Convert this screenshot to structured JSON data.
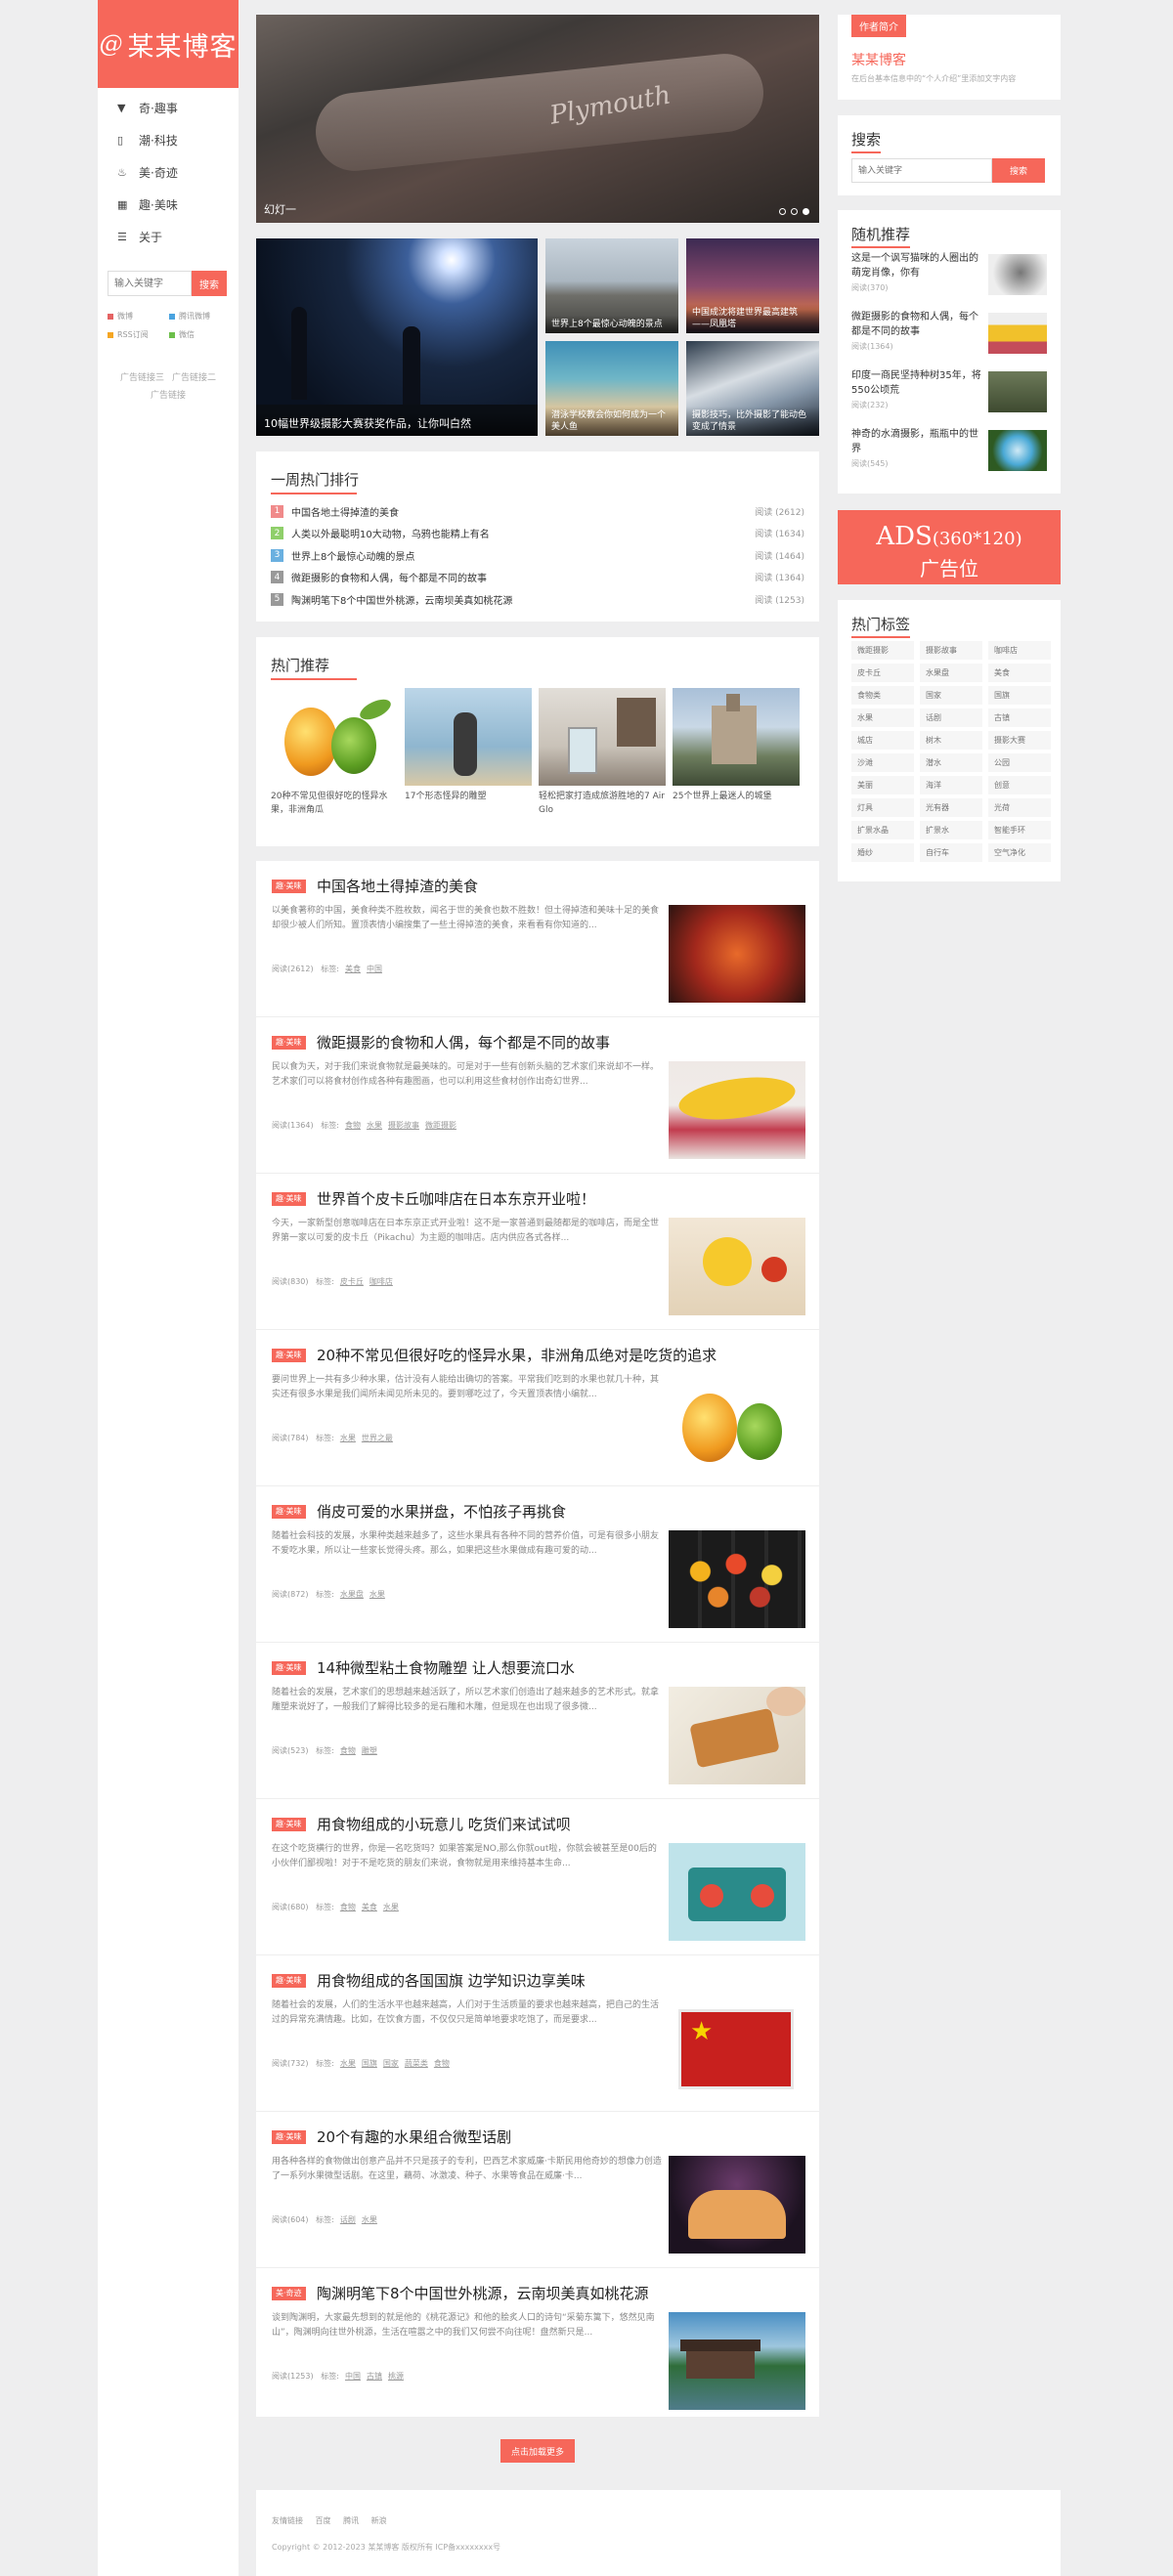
{
  "site": {
    "logo_text": "某某博客",
    "logo_mark": "@"
  },
  "nav": [
    {
      "icon": "funnel-icon",
      "glyph": "▼",
      "label": "奇·趣事"
    },
    {
      "icon": "phone-icon",
      "glyph": "▯",
      "label": "潮·科技"
    },
    {
      "icon": "flame-icon",
      "glyph": "♨",
      "label": "美·奇迹"
    },
    {
      "icon": "grid-icon",
      "glyph": "▦",
      "label": "趣·美味"
    },
    {
      "icon": "list-icon",
      "glyph": "☰",
      "label": "关于"
    }
  ],
  "left_search": {
    "placeholder": "输入关键字",
    "button": "搜索"
  },
  "share": [
    {
      "label": "微博",
      "color": "#e46363"
    },
    {
      "label": "腾讯微博",
      "color": "#4aa3df"
    },
    {
      "label": "RSS订阅",
      "color": "#f5a623"
    },
    {
      "label": "微信",
      "color": "#6cbf4a"
    }
  ],
  "left_links": [
    "广告链接三",
    "广告链接二",
    "广告链接"
  ],
  "slider": {
    "caption": "幻灯一",
    "signature": "Plymouth"
  },
  "mosaic": {
    "big": "10幅世界级摄影大赛获奖作品，让你叫白然",
    "t1": "世界上8个最惊心动魄的景点",
    "t2": "中国成沈将建世界最高建筑——凤凰塔",
    "t3": "潜泳学校教会你如何成为一个美人鱼",
    "t4": "摄影技巧，比外摄影了能动色变成了情景"
  },
  "hot_rank": {
    "title": "一周热门排行",
    "items": [
      {
        "n": "1",
        "title": "中国各地土得掉渣的美食",
        "views": "阅读 (2612)",
        "color": "#f08a8a"
      },
      {
        "n": "2",
        "title": "人类以外最聪明10大动物，乌鸦也能精上有名",
        "views": "阅读 (1634)",
        "color": "#8fcf6a"
      },
      {
        "n": "3",
        "title": "世界上8个最惊心动魄的景点",
        "views": "阅读 (1464)",
        "color": "#6ab0e0"
      },
      {
        "n": "4",
        "title": "微距摄影的食物和人偶，每个都是不同的故事",
        "views": "阅读 (1364)",
        "color": "#999999"
      },
      {
        "n": "5",
        "title": "陶渊明笔下8个中国世外桃源，云南坝美真如桃花源",
        "views": "阅读 (1253)",
        "color": "#999999"
      }
    ]
  },
  "recommend": {
    "title": "热门推荐",
    "items": [
      {
        "title": "20种不常见但很好吃的怪异水果，非洲角瓜"
      },
      {
        "title": "17个形态怪异的雕塑"
      },
      {
        "title": "轻松把家打造成旅游胜地的7 Air Glo"
      },
      {
        "title": "25个世界上最迷人的城堡"
      }
    ]
  },
  "articles": [
    {
      "badge": "趣·美味",
      "title": "中国各地土得掉渣的美食",
      "excerpt": "以美食著称的中国，美食种类不胜枚数，闻名于世的美食也数不胜数！但土得掉渣和美味十足的美食却很少被人们所知。置顶表情小编搜集了一些土得掉渣的美食，来看看有你知道的...",
      "views": "阅读(2612)",
      "tagl": "标签:",
      "tags": [
        "美食",
        "中国"
      ]
    },
    {
      "badge": "趣·美味",
      "title": "微距摄影的食物和人偶，每个都是不同的故事",
      "excerpt": "民以食为天，对于我们来说食物就是最美味的。可是对于一些有创新头脑的艺术家们来说却不一样。艺术家们可以将食材创作成各种有趣图画，也可以利用这些食材创作出奇幻世界...",
      "views": "阅读(1364)",
      "tagl": "标签:",
      "tags": [
        "食物",
        "水果",
        "摄影故事",
        "微距摄影"
      ]
    },
    {
      "badge": "趣·美味",
      "title": "世界首个皮卡丘咖啡店在日本东京开业啦！",
      "excerpt": "今天，一家新型创意咖啡店在日本东京正式开业啦！这不是一家普通到最随都是的咖啡店，而是全世界第一家以可爱的皮卡丘（Pikachu）为主题的咖啡店。店内供应各式各样...",
      "views": "阅读(830)",
      "tagl": "标签:",
      "tags": [
        "皮卡丘",
        "咖啡店"
      ]
    },
    {
      "badge": "趣·美味",
      "title": "20种不常见但很好吃的怪异水果，非洲角瓜绝对是吃货的追求",
      "excerpt": "要问世界上一共有多少种水果，估计没有人能给出确切的答案。平常我们吃到的水果也就几十种，其实还有很多水果是我们闻所未闻见所未见的。要到哪吃过了，今天置顶表情小编就...",
      "views": "阅读(784)",
      "tagl": "标签:",
      "tags": [
        "水果",
        "世界之最"
      ]
    },
    {
      "badge": "趣·美味",
      "title": "俏皮可爱的水果拼盘，不怕孩子再挑食",
      "excerpt": "随着社会科技的发展，水果种类越来越多了，这些水果具有各种不同的营养价值，可是有很多小朋友不爱吃水果，所以让一些家长觉得头疼。那么，如果把这些水果做成有趣可爱的动...",
      "views": "阅读(872)",
      "tagl": "标签:",
      "tags": [
        "水果盘",
        "水果"
      ]
    },
    {
      "badge": "趣·美味",
      "title": "14种微型粘土食物雕塑 让人想要流口水",
      "excerpt": "随着社会的发展，艺术家们的思想越来越活跃了，所以艺术家们创造出了越来越多的艺术形式。就拿雕塑来说好了，一般我们了解得比较多的是石雕和木雕，但是现在也出现了很多微...",
      "views": "阅读(523)",
      "tagl": "标签:",
      "tags": [
        "食物",
        "雕塑"
      ]
    },
    {
      "badge": "趣·美味",
      "title": "用食物组成的小玩意儿 吃货们来试试呗",
      "excerpt": "在这个吃货横行的世界，你是一名吃货吗？如果答案是NO,那么你就out啦，你就会被甚至是00后的小伙伴们鄙视啦！对于不是吃货的朋友们来说，食物就是用来维持基本生命...",
      "views": "阅读(680)",
      "tagl": "标签:",
      "tags": [
        "食物",
        "美食",
        "水果"
      ]
    },
    {
      "badge": "趣·美味",
      "title": "用食物组成的各国国旗 边学知识边享美味",
      "excerpt": "随着社会的发展，人们的生活水平也越来越高，人们对于生活质量的要求也越来越高，把自己的生活过的异常充满情趣。比如，在饮食方面，不仅仅只是简单地要求吃饱了，而是要求...",
      "views": "阅读(732)",
      "tagl": "标签:",
      "tags": [
        "水果",
        "国旗",
        "国家",
        "蔬菜类",
        "食物"
      ]
    },
    {
      "badge": "趣·美味",
      "title": "20个有趣的水果组合微型话剧",
      "excerpt": "用各种各样的食物做出创意产品并不只是孩子的专利，巴西艺术家威廉·卡斯民用他奇妙的想像力创造了一系列水果微型话剧。在这里，藕荷、冰激凌、种子、水果等食品在威廉·卡...",
      "views": "阅读(604)",
      "tagl": "标签:",
      "tags": [
        "话剧",
        "水果"
      ]
    },
    {
      "badge": "美·奇迹",
      "title": "陶渊明笔下8个中国世外桃源，云南坝美真如桃花源",
      "excerpt": "谈到陶渊明，大家最先想到的就是他的《桃花源记》和他的脍炙人口的诗句“采菊东篱下，悠然见南山”，陶渊明向往世外桃源，生活在喧嚣之中的我们又何尝不向往呢！盘然新只是...",
      "views": "阅读(1253)",
      "tagl": "标签:",
      "tags": [
        "中国",
        "古镇",
        "桃源"
      ]
    }
  ],
  "more_button": "点击加载更多",
  "footer": {
    "links": [
      "友情链接",
      "百度",
      "腾讯",
      "新浪"
    ],
    "copyright": "Copyright © 2012-2023 某某博客 版权所有 ICP备xxxxxxxx号"
  },
  "right": {
    "intro_tag": "作者简介",
    "intro_name": "某某博客",
    "intro_desc": "在后台基本信息中的“个人介绍”里添加文字内容",
    "search_title": "搜索",
    "search_placeholder": "输入关键字",
    "search_button": "搜索",
    "random_title": "随机推荐",
    "random": [
      {
        "title": "这是一个讽写猫咪的人圈出的萌宠肖像，你有",
        "views": "阅读(370)"
      },
      {
        "title": "微距摄影的食物和人偶，每个都是不同的故事",
        "views": "阅读(1364)"
      },
      {
        "title": "印度一商民坚持种树35年，将550公顷荒",
        "views": "阅读(232)"
      },
      {
        "title": "神奇的水滴摄影，瓶瓶中的世界",
        "views": "阅读(545)"
      }
    ],
    "ads_line1": "ADS",
    "ads_size": "(360*120)",
    "ads_line2": "广告位",
    "tags_title": "热门标签",
    "tags": [
      "微距摄影",
      "摄影故事",
      "咖啡店",
      "皮卡丘",
      "水果盘",
      "美食",
      "食物类",
      "国家",
      "国旗",
      "水果",
      "话剧",
      "古镇",
      "城店",
      "树木",
      "摄影大赛",
      "沙滩",
      "潜水",
      "公园",
      "美丽",
      "海洋",
      "创意",
      "灯具",
      "光有器",
      "光荷",
      "扩景水晶",
      "扩景水",
      "智能手环",
      "婚纱",
      "自行车",
      "空气净化"
    ]
  }
}
